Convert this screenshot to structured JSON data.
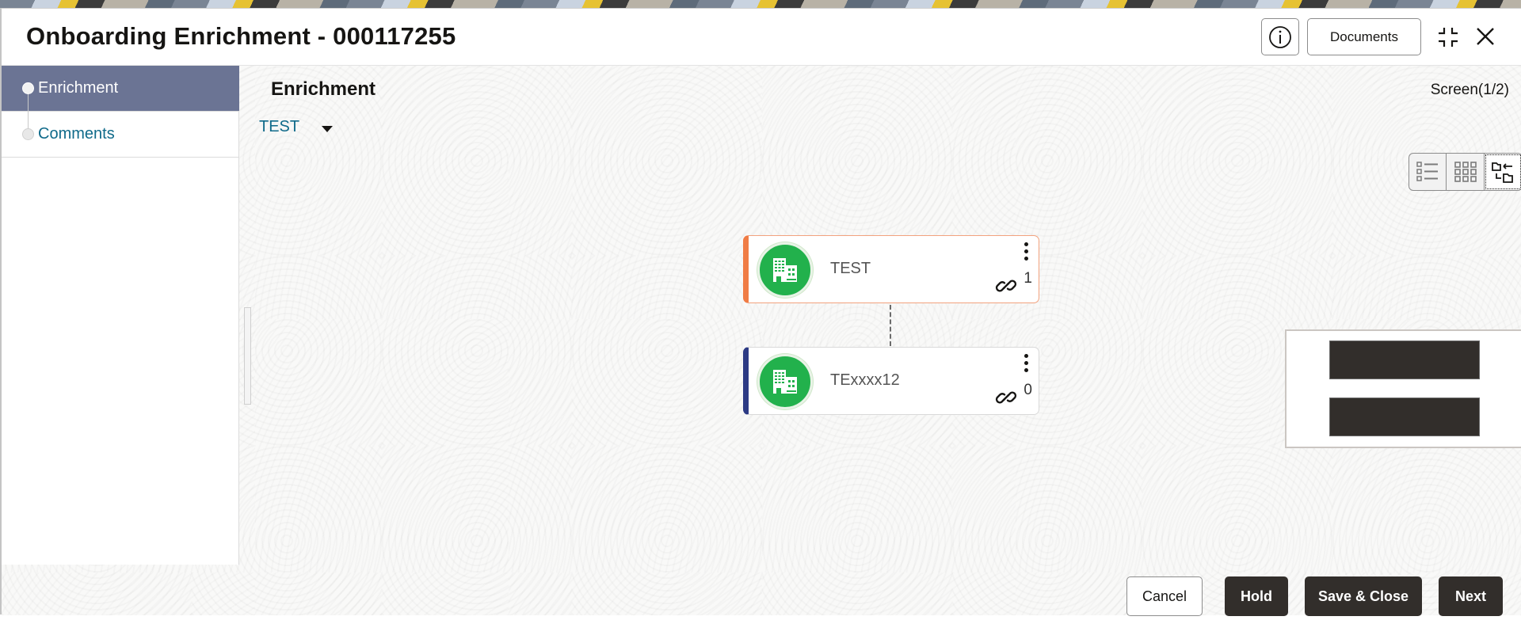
{
  "header": {
    "title": "Onboarding Enrichment - 000117255",
    "info_icon": "info-icon",
    "documents_label": "Documents",
    "collapse_icon": "collapse-icon",
    "close_icon": "close-icon"
  },
  "sidebar": {
    "steps": [
      {
        "label": "Enrichment",
        "active": true
      },
      {
        "label": "Comments",
        "active": false
      }
    ]
  },
  "main": {
    "section_title": "Enrichment",
    "screen_indicator": "Screen(1/2)",
    "entity_selector": {
      "value": "TEST",
      "icon": "caret-down-icon"
    },
    "view_toggle": [
      {
        "icon": "list-view-icon",
        "selected": false
      },
      {
        "icon": "grid-view-icon",
        "selected": false
      },
      {
        "icon": "hierarchy-view-icon",
        "selected": true
      }
    ],
    "hierarchy": {
      "nodes": [
        {
          "name": "TEST",
          "role": "parent",
          "link_count": "1",
          "accent": "#f07c45",
          "icon": "building-icon"
        },
        {
          "name": "TExxxx12",
          "role": "child",
          "link_count": "0",
          "accent": "#2c3a84",
          "icon": "building-icon"
        }
      ]
    }
  },
  "footer": {
    "cancel_label": "Cancel",
    "hold_label": "Hold",
    "save_close_label": "Save & Close",
    "next_label": "Next"
  },
  "colors": {
    "sidebar_active": "#6b7494",
    "link_text": "#0f6a8a",
    "primary_button": "#322e2b",
    "avatar_green": "#22b14c"
  }
}
